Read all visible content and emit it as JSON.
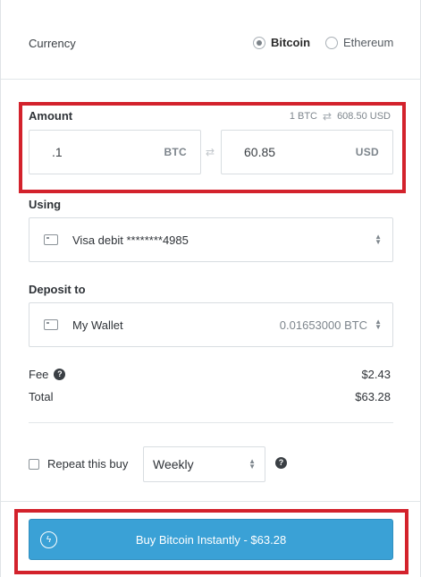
{
  "currency": {
    "label": "Currency",
    "options": [
      {
        "label": "Bitcoin",
        "selected": true
      },
      {
        "label": "Ethereum",
        "selected": false
      }
    ]
  },
  "amount": {
    "label": "Amount",
    "rate_left": "1 BTC",
    "rate_right": "608.50 USD",
    "btc_value": ".1",
    "btc_unit": "BTC",
    "usd_value": "60.85",
    "usd_unit": "USD"
  },
  "using": {
    "label": "Using",
    "value": "Visa debit ********4985"
  },
  "deposit": {
    "label": "Deposit to",
    "value": "My Wallet",
    "balance": "0.01653000 BTC"
  },
  "totals": {
    "fee_label": "Fee",
    "fee_value": "$2.43",
    "total_label": "Total",
    "total_value": "$63.28"
  },
  "repeat": {
    "label": "Repeat this buy",
    "checked": false,
    "frequency": "Weekly"
  },
  "buy_button": {
    "label": "Buy Bitcoin Instantly - $63.28"
  },
  "colors": {
    "accent": "#3aa1d6",
    "highlight": "#d3222c"
  },
  "icons": {
    "help": "?",
    "swap": "⇄",
    "bolt": "ϟ"
  }
}
